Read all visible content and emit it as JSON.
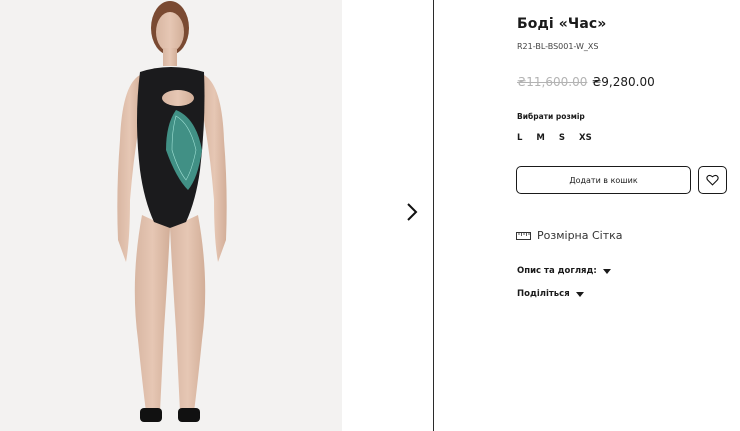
{
  "product": {
    "title": "Боді «Час»",
    "sku": "R21-BL-BS001-W_XS",
    "old_price": "₴11,600.00",
    "new_price": "₴9,280.00"
  },
  "size_selector": {
    "label": "Вибрати розмір",
    "options": [
      "L",
      "M",
      "S",
      "XS"
    ]
  },
  "actions": {
    "add_to_cart": "Додати в кошик",
    "wishlist_icon": "heart-icon"
  },
  "size_chart": {
    "label": "Розмірна Сітка",
    "icon": "ruler-icon"
  },
  "accordions": [
    {
      "label": "Опис та догляд:"
    },
    {
      "label": "Поділіться"
    }
  ],
  "gallery": {
    "next_icon": "chevron-right-icon"
  },
  "colors": {
    "photo_bg": "#f3f2f1",
    "accent_print": "#4fb8a8",
    "border": "#1a1a1a"
  }
}
